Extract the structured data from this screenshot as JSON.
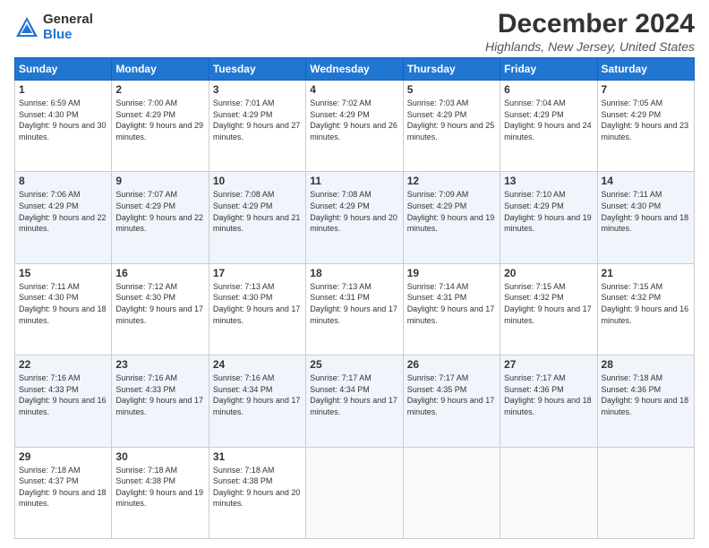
{
  "header": {
    "logo_general": "General",
    "logo_blue": "Blue",
    "month_title": "December 2024",
    "location": "Highlands, New Jersey, United States"
  },
  "weekdays": [
    "Sunday",
    "Monday",
    "Tuesday",
    "Wednesday",
    "Thursday",
    "Friday",
    "Saturday"
  ],
  "weeks": [
    [
      {
        "day": "1",
        "sunrise": "Sunrise: 6:59 AM",
        "sunset": "Sunset: 4:30 PM",
        "daylight": "Daylight: 9 hours and 30 minutes."
      },
      {
        "day": "2",
        "sunrise": "Sunrise: 7:00 AM",
        "sunset": "Sunset: 4:29 PM",
        "daylight": "Daylight: 9 hours and 29 minutes."
      },
      {
        "day": "3",
        "sunrise": "Sunrise: 7:01 AM",
        "sunset": "Sunset: 4:29 PM",
        "daylight": "Daylight: 9 hours and 27 minutes."
      },
      {
        "day": "4",
        "sunrise": "Sunrise: 7:02 AM",
        "sunset": "Sunset: 4:29 PM",
        "daylight": "Daylight: 9 hours and 26 minutes."
      },
      {
        "day": "5",
        "sunrise": "Sunrise: 7:03 AM",
        "sunset": "Sunset: 4:29 PM",
        "daylight": "Daylight: 9 hours and 25 minutes."
      },
      {
        "day": "6",
        "sunrise": "Sunrise: 7:04 AM",
        "sunset": "Sunset: 4:29 PM",
        "daylight": "Daylight: 9 hours and 24 minutes."
      },
      {
        "day": "7",
        "sunrise": "Sunrise: 7:05 AM",
        "sunset": "Sunset: 4:29 PM",
        "daylight": "Daylight: 9 hours and 23 minutes."
      }
    ],
    [
      {
        "day": "8",
        "sunrise": "Sunrise: 7:06 AM",
        "sunset": "Sunset: 4:29 PM",
        "daylight": "Daylight: 9 hours and 22 minutes."
      },
      {
        "day": "9",
        "sunrise": "Sunrise: 7:07 AM",
        "sunset": "Sunset: 4:29 PM",
        "daylight": "Daylight: 9 hours and 22 minutes."
      },
      {
        "day": "10",
        "sunrise": "Sunrise: 7:08 AM",
        "sunset": "Sunset: 4:29 PM",
        "daylight": "Daylight: 9 hours and 21 minutes."
      },
      {
        "day": "11",
        "sunrise": "Sunrise: 7:08 AM",
        "sunset": "Sunset: 4:29 PM",
        "daylight": "Daylight: 9 hours and 20 minutes."
      },
      {
        "day": "12",
        "sunrise": "Sunrise: 7:09 AM",
        "sunset": "Sunset: 4:29 PM",
        "daylight": "Daylight: 9 hours and 19 minutes."
      },
      {
        "day": "13",
        "sunrise": "Sunrise: 7:10 AM",
        "sunset": "Sunset: 4:29 PM",
        "daylight": "Daylight: 9 hours and 19 minutes."
      },
      {
        "day": "14",
        "sunrise": "Sunrise: 7:11 AM",
        "sunset": "Sunset: 4:30 PM",
        "daylight": "Daylight: 9 hours and 18 minutes."
      }
    ],
    [
      {
        "day": "15",
        "sunrise": "Sunrise: 7:11 AM",
        "sunset": "Sunset: 4:30 PM",
        "daylight": "Daylight: 9 hours and 18 minutes."
      },
      {
        "day": "16",
        "sunrise": "Sunrise: 7:12 AM",
        "sunset": "Sunset: 4:30 PM",
        "daylight": "Daylight: 9 hours and 17 minutes."
      },
      {
        "day": "17",
        "sunrise": "Sunrise: 7:13 AM",
        "sunset": "Sunset: 4:30 PM",
        "daylight": "Daylight: 9 hours and 17 minutes."
      },
      {
        "day": "18",
        "sunrise": "Sunrise: 7:13 AM",
        "sunset": "Sunset: 4:31 PM",
        "daylight": "Daylight: 9 hours and 17 minutes."
      },
      {
        "day": "19",
        "sunrise": "Sunrise: 7:14 AM",
        "sunset": "Sunset: 4:31 PM",
        "daylight": "Daylight: 9 hours and 17 minutes."
      },
      {
        "day": "20",
        "sunrise": "Sunrise: 7:15 AM",
        "sunset": "Sunset: 4:32 PM",
        "daylight": "Daylight: 9 hours and 17 minutes."
      },
      {
        "day": "21",
        "sunrise": "Sunrise: 7:15 AM",
        "sunset": "Sunset: 4:32 PM",
        "daylight": "Daylight: 9 hours and 16 minutes."
      }
    ],
    [
      {
        "day": "22",
        "sunrise": "Sunrise: 7:16 AM",
        "sunset": "Sunset: 4:33 PM",
        "daylight": "Daylight: 9 hours and 16 minutes."
      },
      {
        "day": "23",
        "sunrise": "Sunrise: 7:16 AM",
        "sunset": "Sunset: 4:33 PM",
        "daylight": "Daylight: 9 hours and 17 minutes."
      },
      {
        "day": "24",
        "sunrise": "Sunrise: 7:16 AM",
        "sunset": "Sunset: 4:34 PM",
        "daylight": "Daylight: 9 hours and 17 minutes."
      },
      {
        "day": "25",
        "sunrise": "Sunrise: 7:17 AM",
        "sunset": "Sunset: 4:34 PM",
        "daylight": "Daylight: 9 hours and 17 minutes."
      },
      {
        "day": "26",
        "sunrise": "Sunrise: 7:17 AM",
        "sunset": "Sunset: 4:35 PM",
        "daylight": "Daylight: 9 hours and 17 minutes."
      },
      {
        "day": "27",
        "sunrise": "Sunrise: 7:17 AM",
        "sunset": "Sunset: 4:36 PM",
        "daylight": "Daylight: 9 hours and 18 minutes."
      },
      {
        "day": "28",
        "sunrise": "Sunrise: 7:18 AM",
        "sunset": "Sunset: 4:36 PM",
        "daylight": "Daylight: 9 hours and 18 minutes."
      }
    ],
    [
      {
        "day": "29",
        "sunrise": "Sunrise: 7:18 AM",
        "sunset": "Sunset: 4:37 PM",
        "daylight": "Daylight: 9 hours and 18 minutes."
      },
      {
        "day": "30",
        "sunrise": "Sunrise: 7:18 AM",
        "sunset": "Sunset: 4:38 PM",
        "daylight": "Daylight: 9 hours and 19 minutes."
      },
      {
        "day": "31",
        "sunrise": "Sunrise: 7:18 AM",
        "sunset": "Sunset: 4:38 PM",
        "daylight": "Daylight: 9 hours and 20 minutes."
      },
      null,
      null,
      null,
      null
    ]
  ]
}
